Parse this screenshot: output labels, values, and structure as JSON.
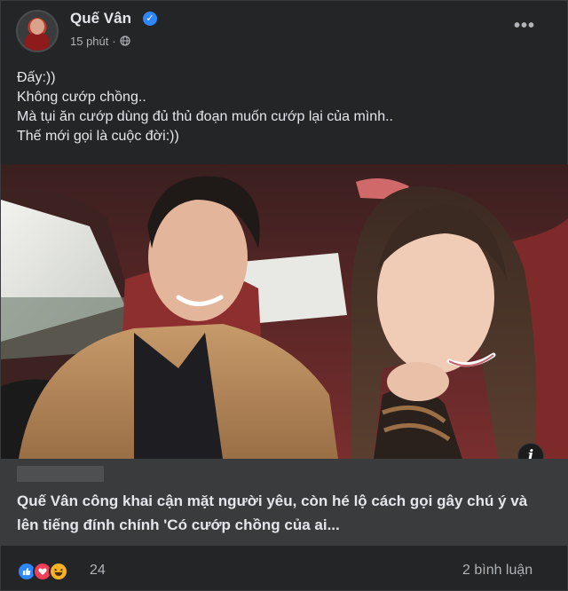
{
  "post": {
    "author": "Quế Vân",
    "time": "15 phút",
    "separator": "·",
    "caption_lines": [
      "Đấy:))",
      "Không cướp chồng..",
      "Mà tụi ăn cướp dùng đủ thủ đoạn muốn cướp lại của mình..",
      "Thế mới gọi là cuộc đời:))"
    ],
    "info_glyph": "i",
    "verified_glyph": "✓",
    "more_glyph": "•••"
  },
  "link_preview": {
    "title": "Quế Vân công khai cận mặt người yêu, còn hé lộ cách gọi gây chú ý và lên tiếng đính chính 'Có cướp chồng của ai..."
  },
  "footer": {
    "reaction_count": "24",
    "comments": "2 bình luận",
    "reaction_icons": [
      "like-icon",
      "love-icon",
      "haha-icon"
    ]
  },
  "colors": {
    "background": "#242526",
    "text": "#e4e6eb",
    "muted": "#b0b3b8",
    "link_bg": "#3a3b3c",
    "accent": "#2d88ff"
  }
}
